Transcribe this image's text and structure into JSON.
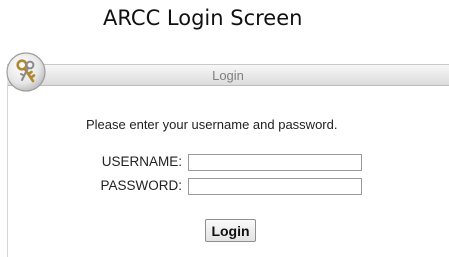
{
  "caption": "ARCC Login Screen",
  "panel": {
    "title": "Login",
    "icon": "keys-icon"
  },
  "form": {
    "prompt": "Please enter your username and password.",
    "username_label": "USERNAME:",
    "username_value": "",
    "password_label": "PASSWORD:",
    "password_value": "",
    "submit_label": "Login"
  }
}
